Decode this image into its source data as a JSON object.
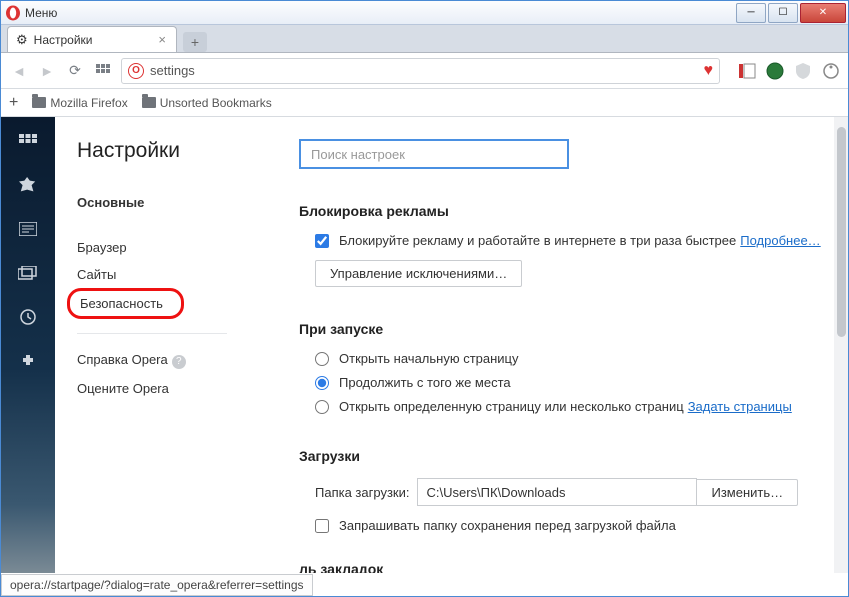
{
  "titlebar": {
    "menu": "Меню"
  },
  "tab": {
    "title": "Настройки"
  },
  "addressbar": {
    "value": "settings"
  },
  "bookmarks": {
    "folder1": "Mozilla Firefox",
    "folder2": "Unsorted Bookmarks"
  },
  "sidebar": {
    "heading": "Настройки",
    "items": [
      "Основные",
      "Браузер",
      "Сайты",
      "Безопасность"
    ],
    "help": "Справка Opera",
    "rate": "Оцените Opera"
  },
  "search": {
    "placeholder": "Поиск настроек"
  },
  "adblock": {
    "title": "Блокировка рекламы",
    "cb_label": "Блокируйте рекламу и работайте в интернете в три раза быстрее",
    "more": "Подробнее…",
    "manage": "Управление исключениями…"
  },
  "startup": {
    "title": "При запуске",
    "opt1": "Открыть начальную страницу",
    "opt2": "Продолжить с того же места",
    "opt3": "Открыть определенную страницу или несколько страниц",
    "set_pages": "Задать страницы"
  },
  "downloads": {
    "title": "Загрузки",
    "folder_label": "Папка загрузки:",
    "folder_value": "C:\\Users\\ПК\\Downloads",
    "change": "Изменить…",
    "ask": "Запрашивать папку сохранения перед загрузкой файла"
  },
  "bookmarks_bar_title": "ль закладок",
  "statusbar": "opera://startpage/?dialog=rate_opera&referrer=settings"
}
